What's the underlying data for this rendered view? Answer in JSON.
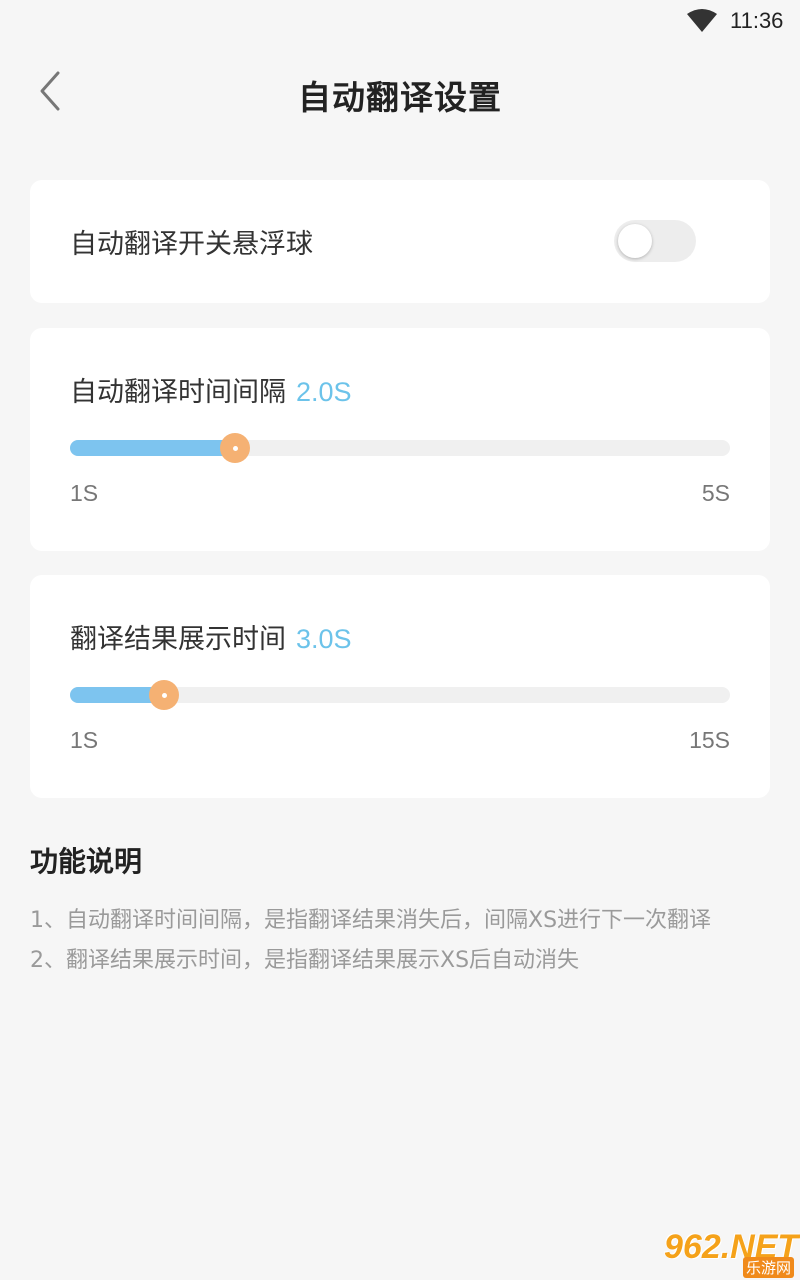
{
  "status_bar": {
    "time": "11:36",
    "wifi_icon": "wifi-icon"
  },
  "header": {
    "title": "自动翻译设置",
    "back_icon": "chevron-left-icon"
  },
  "toggle_card": {
    "label": "自动翻译开关悬浮球",
    "enabled": false
  },
  "interval_slider": {
    "title": "自动翻译时间间隔",
    "value_text": "2.0S",
    "min_label": "1S",
    "max_label": "5S",
    "min": 1,
    "max": 5,
    "value": 2.0
  },
  "display_slider": {
    "title": "翻译结果展示时间",
    "value_text": "3.0S",
    "min_label": "1S",
    "max_label": "15S",
    "min": 1,
    "max": 15,
    "value": 3.0
  },
  "description": {
    "heading": "功能说明",
    "lines": [
      "1、自动翻译时间间隔，是指翻译结果消失后，间隔XS进行下一次翻译",
      "2、翻译结果展示时间，是指翻译结果展示XS后自动消失"
    ]
  },
  "watermark": {
    "main": "962.NET",
    "sub": "乐游网"
  },
  "colors": {
    "accent": "#6cc3ea",
    "slider_fill": "#7dc4ef",
    "thumb": "#f5b173",
    "background": "#f6f6f6"
  }
}
